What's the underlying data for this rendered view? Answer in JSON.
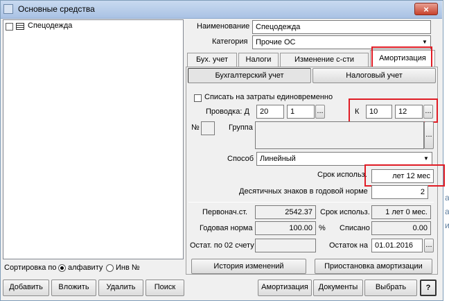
{
  "window": {
    "title": "Основные средства",
    "close_label": "×"
  },
  "tree": {
    "items": [
      {
        "label": "Спецодежда"
      }
    ]
  },
  "sort": {
    "label": "Сортировка по",
    "options": [
      "алфавиту",
      "Инв №"
    ],
    "selected": 0
  },
  "bottom_left_buttons": [
    "Добавить",
    "Вложить",
    "Удалить",
    "Поиск"
  ],
  "form": {
    "name_label": "Наименование",
    "name_value": "Спецодежда",
    "category_label": "Категория",
    "category_value": "Прочие ОС",
    "tabs": [
      "Бух. учет",
      "Налоги",
      "Изменение с-сти",
      "Амортизация"
    ],
    "active_tab": 3,
    "subtabs": [
      "Бухгалтерский учет",
      "Налоговый учет"
    ],
    "writeoff_label": "Списать на затраты единовременно",
    "entry_label": "Проводка:  Д",
    "debit_account": "20",
    "debit_sub": "1",
    "credit_label": "К",
    "credit_account": "10",
    "credit_sub": "12",
    "ellipsis": "...",
    "number_label": "№",
    "group_label": "Группа",
    "method_label": "Способ",
    "method_value": "Линейный",
    "term_label": "Срок использ.",
    "term_value": "лет  12 мес",
    "decimals_label": "Десятичных знаков в годовой норме",
    "decimals_value": "2",
    "initial_cost_label": "Первонач.ст.",
    "initial_cost_value": "2542.37",
    "term2_label": "Срок использ.",
    "term2_value": "1 лет  0 мес.",
    "annual_rate_label": "Годовая норма",
    "annual_rate_value": "100.00",
    "percent_sign": "%",
    "written_off_label": "Списано",
    "written_off_value": "0.00",
    "balance02_label": "Остат. по 02 счету",
    "balance02_value": "",
    "balance_on_label": "Остаток на",
    "balance_on_date": "01.01.2016",
    "history_button": "История изменений",
    "suspend_button": "Приостановка амортизации"
  },
  "bottom_right_buttons": [
    "Амортизация",
    "Документы",
    "Выбрать",
    "?"
  ],
  "accent_colors": {
    "highlight_red": "#e01b24",
    "titlebar": "#b7cde9",
    "close": "#c7422c"
  }
}
